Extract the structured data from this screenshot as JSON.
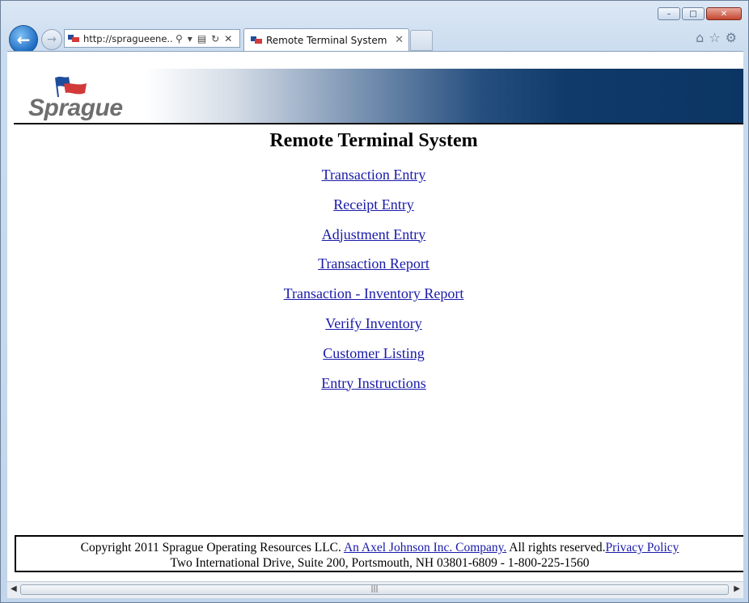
{
  "browser": {
    "address": "http://spragueene...",
    "tab_title": "Remote Terminal System",
    "window_buttons": {
      "minimize": "–",
      "maximize": "□",
      "close": "✕"
    }
  },
  "page": {
    "logo_text": "Sprague",
    "title": "Remote Terminal System",
    "menu": [
      {
        "label": "Transaction Entry"
      },
      {
        "label": "Receipt Entry"
      },
      {
        "label": "Adjustment Entry"
      },
      {
        "label": "Transaction Report"
      },
      {
        "label": "Transaction - Inventory Report"
      },
      {
        "label": "Verify Inventory"
      },
      {
        "label": "Customer Listing"
      },
      {
        "label": "Entry Instructions"
      }
    ],
    "footer": {
      "copyright": "Copyright 2011 Sprague Operating Resources LLC.",
      "company_link": "An Axel Johnson Inc. Company.",
      "rights": " All rights reserved.",
      "privacy_link": "Privacy Policy",
      "address": "Two International Drive, Suite 200, Portsmouth, NH 03801-6809 - 1-800-225-1560"
    }
  },
  "icons": {
    "back": "back-arrow-icon",
    "forward": "forward-arrow-icon",
    "search": "search-icon",
    "refresh": "refresh-icon",
    "stop": "close-icon",
    "home": "home-icon",
    "favorites": "star-icon",
    "settings": "gear-icon"
  },
  "colors": {
    "link": "#1a1aaa",
    "banner_dark": "#0c3563"
  }
}
